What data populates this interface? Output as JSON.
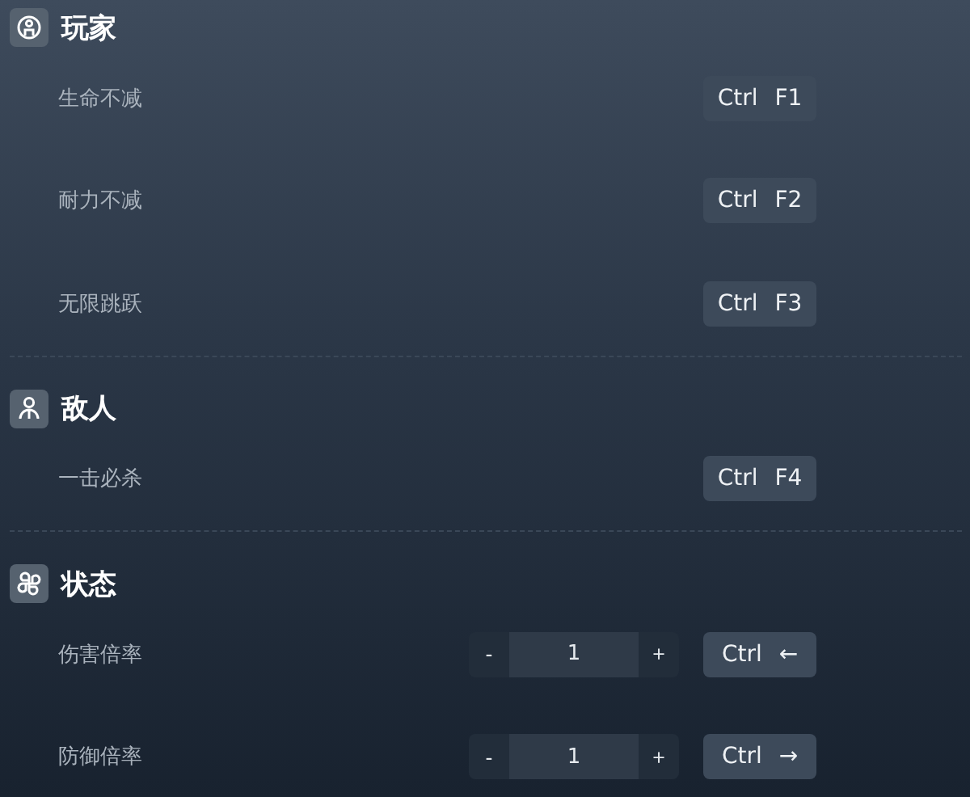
{
  "sections": [
    {
      "title": "玩家",
      "rows": [
        {
          "label": "生命不减",
          "kind": "toggle",
          "hotkey": "Ctrl F1"
        },
        {
          "label": "耐力不减",
          "kind": "toggle",
          "hotkey": "Ctrl F2"
        },
        {
          "label": "无限跳跃",
          "kind": "toggle",
          "hotkey": "Ctrl F3"
        }
      ]
    },
    {
      "title": "敌人",
      "rows": [
        {
          "label": "一击必杀",
          "kind": "toggle",
          "hotkey": "Ctrl F4"
        }
      ]
    },
    {
      "title": "状态",
      "rows": [
        {
          "label": "伤害倍率",
          "kind": "number",
          "minus": "-",
          "value": "1",
          "plus": "+",
          "hotkey": "Ctrl ←"
        },
        {
          "label": "防御倍率",
          "kind": "number",
          "minus": "-",
          "value": "1",
          "plus": "+",
          "hotkey": "Ctrl →"
        }
      ]
    }
  ]
}
